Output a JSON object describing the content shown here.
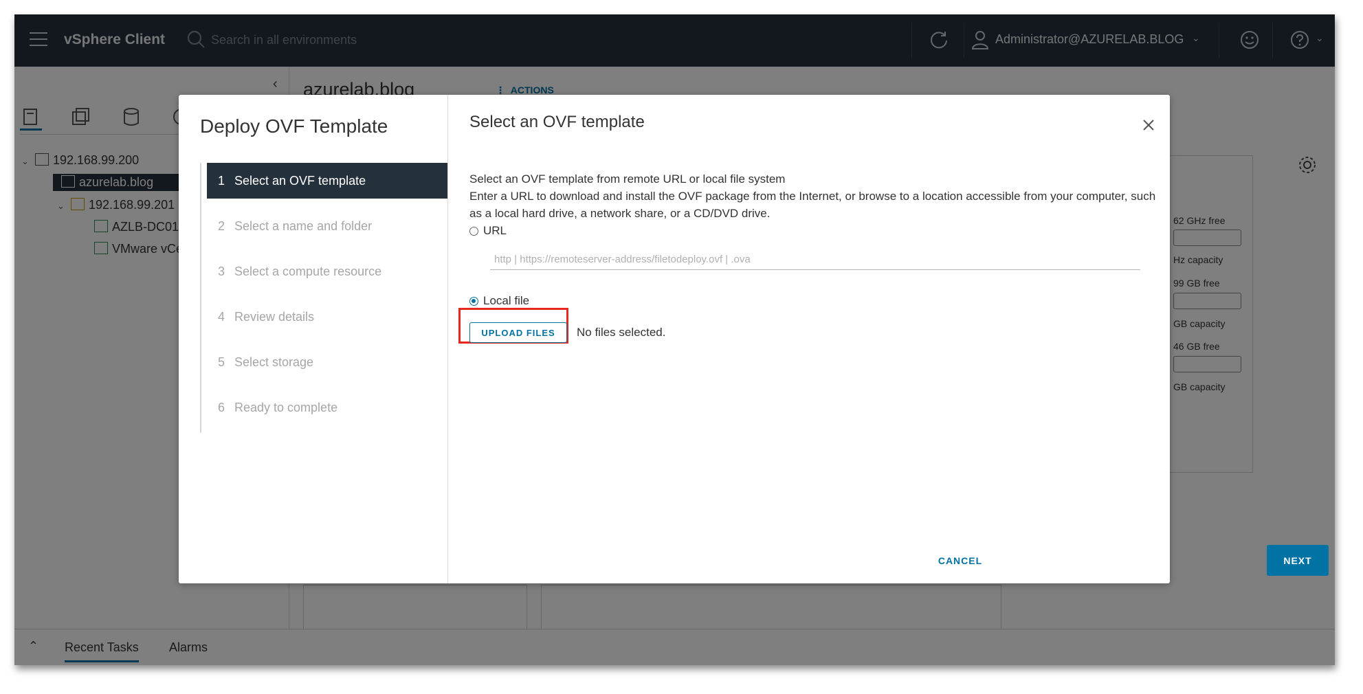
{
  "header": {
    "app_title": "vSphere Client",
    "search_placeholder": "Search in all environments",
    "user": "Administrator@AZURELAB.BLOG"
  },
  "navigator": {
    "tree": [
      {
        "label": "192.168.99.200"
      },
      {
        "label": "azurelab.blog"
      },
      {
        "label": "192.168.99.201"
      },
      {
        "label": "AZLB-DC01"
      },
      {
        "label": "VMware vCenter"
      }
    ]
  },
  "object": {
    "title": "azurelab.blog",
    "actions_label": "ACTIONS"
  },
  "summary_stats": [
    "62 GHz free",
    "Hz capacity",
    "99 GB free",
    "GB capacity",
    "46 GB free",
    "GB capacity"
  ],
  "bottom_tabs": [
    "Recent Tasks",
    "Alarms"
  ],
  "wizard": {
    "title": "Deploy OVF Template",
    "steps": [
      {
        "num": "1",
        "label": "Select an OVF template"
      },
      {
        "num": "2",
        "label": "Select a name and folder"
      },
      {
        "num": "3",
        "label": "Select a compute resource"
      },
      {
        "num": "4",
        "label": "Review details"
      },
      {
        "num": "5",
        "label": "Select storage"
      },
      {
        "num": "6",
        "label": "Ready to complete"
      }
    ],
    "active_step": 1,
    "page_title": "Select an OVF template",
    "desc_line1": "Select an OVF template from remote URL or local file system",
    "desc_line2": "Enter a URL to download and install the OVF package from the Internet, or browse to a location accessible from your computer, such as a local hard drive, a network share, or a CD/DVD drive.",
    "url_option": "URL",
    "url_placeholder": "http | https://remoteserver-address/filetodeploy.ovf | .ova",
    "local_option": "Local file",
    "selected_option": "Local file",
    "upload_label": "UPLOAD FILES",
    "no_files_text": "No files selected.",
    "cancel_label": "CANCEL",
    "next_label": "NEXT"
  },
  "colors": {
    "header_bg": "#24303b",
    "accent": "#0072a3",
    "highlight": "#e8281d"
  }
}
